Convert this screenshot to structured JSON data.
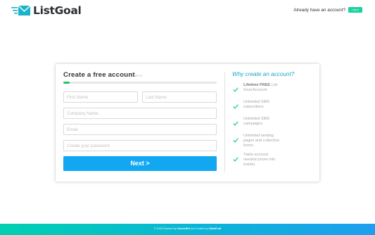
{
  "header": {
    "brand": "ListGoal",
    "account_prompt": "Already have an account?",
    "login_label": "Log in",
    "logo_icon": "envelope-speed-icon",
    "brand_color": "#1ab3c8"
  },
  "form": {
    "title": "Create a free account",
    "step": "STEP 1/2",
    "progress": 0.04,
    "first_name_placeholder": "First Name",
    "last_name_placeholder": "Last Name",
    "company_placeholder": "Company Name",
    "email_placeholder": "Email",
    "password_placeholder": "Create your password",
    "next_label": "Next >",
    "next_color": "#12a8f1"
  },
  "benefits": {
    "title": "Why create an account?",
    "items": [
      {
        "bold": "Lifetime FREE",
        "text": " List Goal Account"
      },
      {
        "bold": "",
        "text": "Unlimited SMS subscribers"
      },
      {
        "bold": "",
        "text": "Unlimited SMS campaigns"
      },
      {
        "bold": "",
        "text": "Unlimited landing pages and collection forms"
      },
      {
        "bold": "",
        "text": "Twilio account needed (more info inside)"
      }
    ],
    "check_icon": "check-icon",
    "check_color": "#1bd1a0"
  },
  "footer": {
    "prefix": "© 2018 Powered by ",
    "powered_by": "ConvertKit",
    "middle": " and Created by ",
    "created_by": "VideoFruit"
  }
}
